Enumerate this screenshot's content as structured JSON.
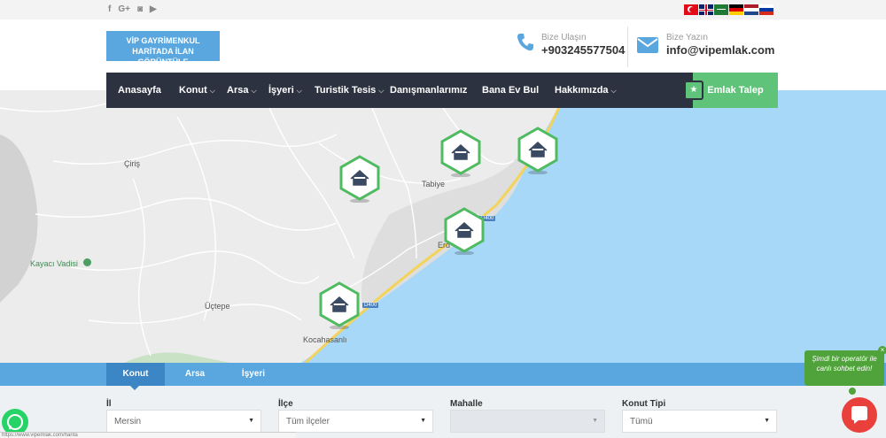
{
  "topbar": {
    "social": [
      {
        "icon": "facebook-icon",
        "glyph": "f"
      },
      {
        "icon": "google-plus-icon",
        "glyph": "G+"
      },
      {
        "icon": "instagram-icon",
        "glyph": "◙"
      },
      {
        "icon": "youtube-icon",
        "glyph": "▶"
      }
    ],
    "flags": [
      "turkish-flag-icon",
      "uk-flag-icon",
      "saudi-flag-icon",
      "german-flag-icon",
      "dutch-flag-icon",
      "russian-flag-icon"
    ]
  },
  "header": {
    "logo_line1": "VİP GAYRİMENKUL",
    "logo_line2": "HARİTADA İLAN GÖRÜNTÜLE",
    "phone_label": "Bize Ulaşın",
    "phone_value": "+903245577504",
    "email_label": "Bize Yazın",
    "email_value": "info@vipemlak.com"
  },
  "nav": {
    "items": [
      {
        "label": "Anasayfa",
        "caret": false
      },
      {
        "label": "Konut",
        "caret": true
      },
      {
        "label": "Arsa",
        "caret": true
      },
      {
        "label": "İşyeri",
        "caret": true
      },
      {
        "label": "Turistik Tesis",
        "caret": true
      },
      {
        "label": "Danışmanlarımız",
        "caret": false
      },
      {
        "label": "Bana Ev Bul",
        "caret": false
      },
      {
        "label": "Hakkımızda",
        "caret": true
      }
    ],
    "emlak_talep": "Emlak Talep"
  },
  "map": {
    "places": [
      "Çiriş",
      "Tabiye",
      "Erd",
      "Kayacı Vadisi",
      "Üçtepe",
      "Kocahasanlı"
    ],
    "road_badges": [
      "D400",
      "D400"
    ]
  },
  "search": {
    "tabs": [
      "Konut",
      "Arsa",
      "İşyeri"
    ],
    "active_tab": 0,
    "fields": [
      {
        "label": "İl",
        "value": "Mersin",
        "disabled": false
      },
      {
        "label": "İlçe",
        "value": "Tüm ilçeler",
        "disabled": false
      },
      {
        "label": "Mahalle",
        "value": "",
        "disabled": true
      },
      {
        "label": "Konut Tipi",
        "value": "Tümü",
        "disabled": false
      }
    ]
  },
  "status_url": "https://www.vipemlak.com/harita",
  "chat": {
    "bubble_text": "Şimdi bir operatör ile canlı sohbet edin!",
    "close": "×"
  },
  "colors": {
    "nav_bg": "#2c3240",
    "accent_green": "#5fc47a",
    "accent_blue": "#5aa7e0",
    "sea": "#a8d8f8",
    "marker_green": "#4fbb60",
    "chat_red": "#e9403b"
  }
}
